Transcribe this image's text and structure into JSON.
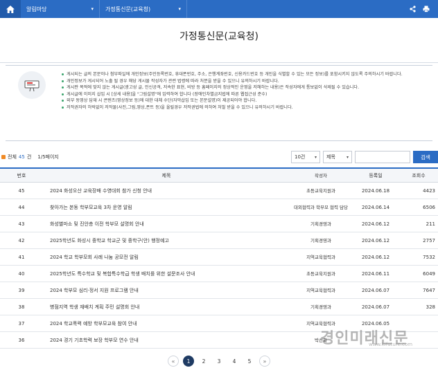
{
  "nav": {
    "crumbs": [
      "알림마당",
      "가정통신문(교육청)"
    ]
  },
  "page": {
    "title": "가정통신문(교육청)"
  },
  "notice": {
    "items": [
      "게시되는 글의 본문이나 첨부파일에 개인정보(주민등록번호, 휴대폰번호, 주소, 은행계좌번호, 신용카드번호 등 개인을 식별할 수 있는 모든 정보)를 포함시키지 않도록 주의하시기 바랍니다.",
      "개인정보가 게시되어 노출 될 경우 해당 게시물 작성자가 관련 법령에 따라 처분을 받을 수 있으니 유의하시기 바랍니다.",
      "게시판 목적에 맞지 않는 게시글(광고성 글, 인신공격, 저속한 표현, 비방 등 홈페이지의 정상적인 운영을 저해하는 내용)은 작성자에게 통보없이 삭제될 수 있습니다.",
      "게시글에 이미지 삽입 시 [상세 내용]을 \"그림설명\"에 입력하여 합니다 (장애인차별금지법에 따른 웹접근성 준수)",
      "외부 동영상 답재 시 콘텐츠(영상정보 등)에 대한 대체 수단(자막삽입 또는 본문설명)이 제공되어야 합니다.",
      "저작권자의 허락없이 저작물(사진,그림,영상,폰트 등)을 올릴경우 저작권법에 의하여 처벌 받을 수 있으니 유의하시기 바랍니다."
    ]
  },
  "search": {
    "total_prefix": "전체",
    "total_count": "45",
    "total_suffix": "건",
    "page_info": "1/5페이지",
    "per_page": "10건",
    "field": "제목",
    "button": "검색"
  },
  "table": {
    "headers": {
      "no": "번호",
      "title": "제목",
      "author": "작성자",
      "date": "등록일",
      "views": "조회수"
    },
    "rows": [
      {
        "no": "45",
        "title": "2024 화성오산 교육장배 수영대회 참가 신청 안내",
        "author": "초등교육지원과",
        "date": "2024.06.18",
        "views": "4423"
      },
      {
        "no": "44",
        "title": "찾아가는 본동 학부모교육 3차 운영 알림",
        "author": "대외협력과 학부모 협력 담당",
        "date": "2024.06.14",
        "views": "6506"
      },
      {
        "no": "43",
        "title": "화성별마소 및 진안층 이전 학부모 설명회 안내",
        "author": "기획경영과",
        "date": "2024.06.12",
        "views": "211"
      },
      {
        "no": "42",
        "title": "2025학년도 화성시 중학교 학교군 및 중학구(안) 행정예고",
        "author": "기획경영과",
        "date": "2024.06.12",
        "views": "2757"
      },
      {
        "no": "41",
        "title": "2024 학교 학부모회 사례 나눔 공모전 알림",
        "author": "지역교육협력과",
        "date": "2024.06.12",
        "views": "7532"
      },
      {
        "no": "40",
        "title": "2025학년도 특수학교 및 복합특수학급 학생 배치를 위한 설문조사 안내",
        "author": "초등교육지원과",
        "date": "2024.06.11",
        "views": "6049"
      },
      {
        "no": "39",
        "title": "2024 학부모 심리·정서 지원 프로그램 안내",
        "author": "지역교육협력과",
        "date": "2024.06.07",
        "views": "7647"
      },
      {
        "no": "38",
        "title": "병점지역 학생 재배치 계획 주민 설명회 안내",
        "author": "기획경영과",
        "date": "2024.06.07",
        "views": "328"
      },
      {
        "no": "37",
        "title": "2024 학교폭력 예방 학부모교육 참여 안내",
        "author": "지역교육협력과",
        "date": "2024.06.05",
        "views": ""
      },
      {
        "no": "36",
        "title": "2024 경기 기초학력 보장 학부모 연수 안내",
        "author": "박선화",
        "date": "",
        "views": ""
      }
    ]
  },
  "pagination": {
    "pages": [
      "1",
      "2",
      "3",
      "4",
      "5"
    ],
    "current": "1"
  },
  "watermark": {
    "text": "경인미래신문",
    "url": "www.kifuture.com"
  }
}
